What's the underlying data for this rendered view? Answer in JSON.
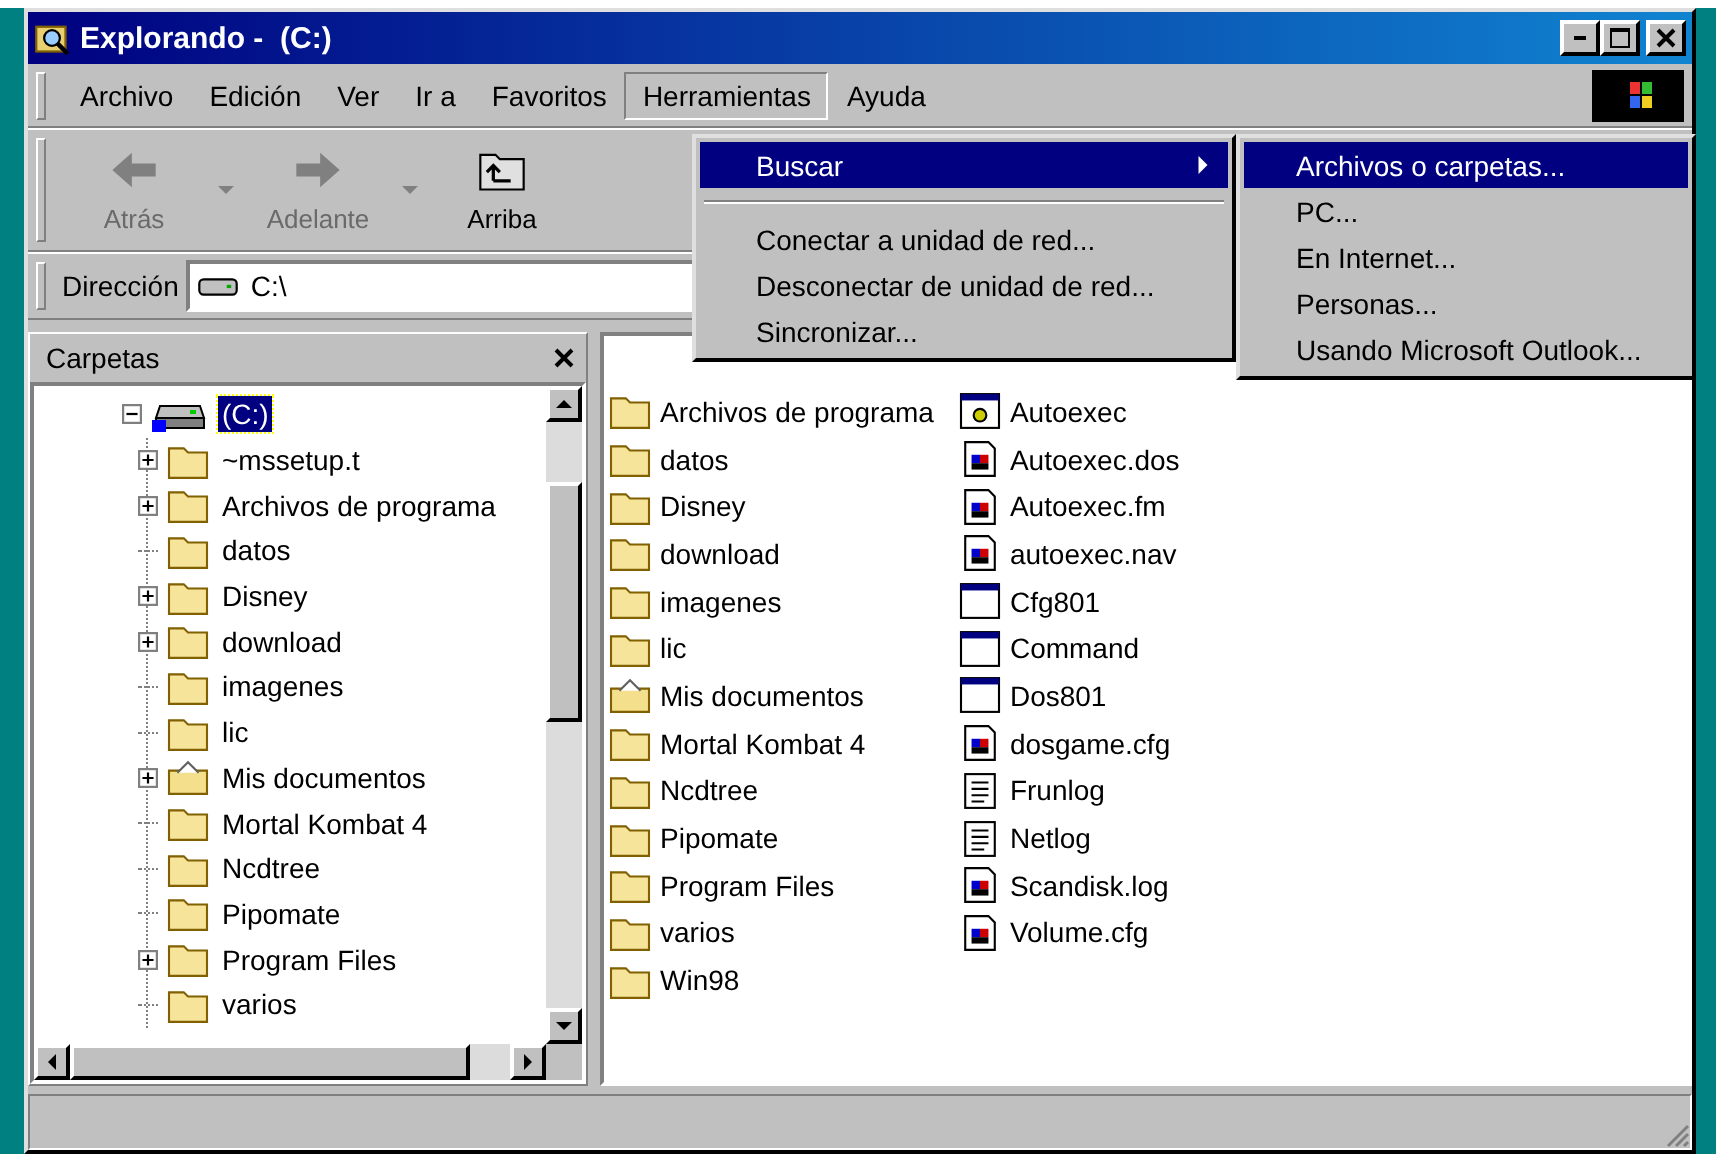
{
  "window": {
    "title": "Explorando -  (C:)"
  },
  "menubar": [
    {
      "label": "Archivo",
      "open": false
    },
    {
      "label": "Edición",
      "open": false
    },
    {
      "label": "Ver",
      "open": false
    },
    {
      "label": "Ir a",
      "open": false
    },
    {
      "label": "Favoritos",
      "open": false
    },
    {
      "label": "Herramientas",
      "open": true
    },
    {
      "label": "Ayuda",
      "open": false
    }
  ],
  "toolbar": [
    {
      "label": "Atrás",
      "kind": "back",
      "disabled": true,
      "dropdown": true
    },
    {
      "label": "Adelante",
      "kind": "forward",
      "disabled": true,
      "dropdown": true
    },
    {
      "label": "Arriba",
      "kind": "up",
      "disabled": false,
      "dropdown": false
    }
  ],
  "address": {
    "label": "Dirección",
    "value": "C:\\"
  },
  "tree": {
    "title": "Carpetas",
    "root": {
      "label": "(C:)",
      "selected": true,
      "expanded": true,
      "children": [
        {
          "label": "~mssetup.t",
          "kind": "folder",
          "expandable": true
        },
        {
          "label": "Archivos de programa",
          "kind": "folder",
          "expandable": true
        },
        {
          "label": "datos",
          "kind": "folder",
          "expandable": false
        },
        {
          "label": "Disney",
          "kind": "folder",
          "expandable": true
        },
        {
          "label": "download",
          "kind": "folder",
          "expandable": true
        },
        {
          "label": "imagenes",
          "kind": "folder",
          "expandable": false
        },
        {
          "label": "lic",
          "kind": "folder",
          "expandable": false
        },
        {
          "label": "Mis documentos",
          "kind": "docs-folder",
          "expandable": true
        },
        {
          "label": "Mortal Kombat 4",
          "kind": "folder",
          "expandable": false
        },
        {
          "label": "Ncdtree",
          "kind": "folder",
          "expandable": false
        },
        {
          "label": "Pipomate",
          "kind": "folder",
          "expandable": false
        },
        {
          "label": "Program Files",
          "kind": "folder",
          "expandable": true
        },
        {
          "label": "varios",
          "kind": "folder",
          "expandable": false
        }
      ]
    }
  },
  "files": [
    {
      "label": "Archivos de programa",
      "kind": "folder"
    },
    {
      "label": "datos",
      "kind": "folder"
    },
    {
      "label": "Disney",
      "kind": "folder"
    },
    {
      "label": "download",
      "kind": "folder"
    },
    {
      "label": "imagenes",
      "kind": "folder"
    },
    {
      "label": "lic",
      "kind": "folder"
    },
    {
      "label": "Mis documentos",
      "kind": "docs-folder"
    },
    {
      "label": "Mortal Kombat 4",
      "kind": "folder"
    },
    {
      "label": "Ncdtree",
      "kind": "folder"
    },
    {
      "label": "Pipomate",
      "kind": "folder"
    },
    {
      "label": "Program Files",
      "kind": "folder"
    },
    {
      "label": "varios",
      "kind": "folder"
    },
    {
      "label": "Win98",
      "kind": "folder"
    },
    {
      "label": "Autoexec",
      "kind": "settings-file"
    },
    {
      "label": "Autoexec.dos",
      "kind": "system-file"
    },
    {
      "label": "Autoexec.fm",
      "kind": "system-file"
    },
    {
      "label": "autoexec.nav",
      "kind": "system-file"
    },
    {
      "label": "Cfg801",
      "kind": "program"
    },
    {
      "label": "Command",
      "kind": "program"
    },
    {
      "label": "Dos801",
      "kind": "program"
    },
    {
      "label": "dosgame.cfg",
      "kind": "system-file"
    },
    {
      "label": "Frunlog",
      "kind": "text-file"
    },
    {
      "label": "Netlog",
      "kind": "text-file"
    },
    {
      "label": "Scandisk.log",
      "kind": "system-file"
    },
    {
      "label": "Volume.cfg",
      "kind": "system-file"
    }
  ],
  "menu": {
    "items": [
      {
        "label": "Buscar",
        "kind": "submenu",
        "selected": true
      },
      {
        "kind": "separator"
      },
      {
        "label": "Conectar a unidad de red...",
        "kind": "item",
        "selected": false
      },
      {
        "label": "Desconectar de unidad de red...",
        "kind": "item",
        "selected": false
      },
      {
        "label": "Sincronizar...",
        "kind": "item",
        "selected": false
      }
    ],
    "submenu": [
      {
        "label": "Archivos o carpetas...",
        "selected": true
      },
      {
        "label": "PC...",
        "selected": false
      },
      {
        "label": "En Internet...",
        "selected": false
      },
      {
        "label": "Personas...",
        "selected": false
      },
      {
        "label": "Usando Microsoft Outlook...",
        "selected": false
      }
    ]
  }
}
